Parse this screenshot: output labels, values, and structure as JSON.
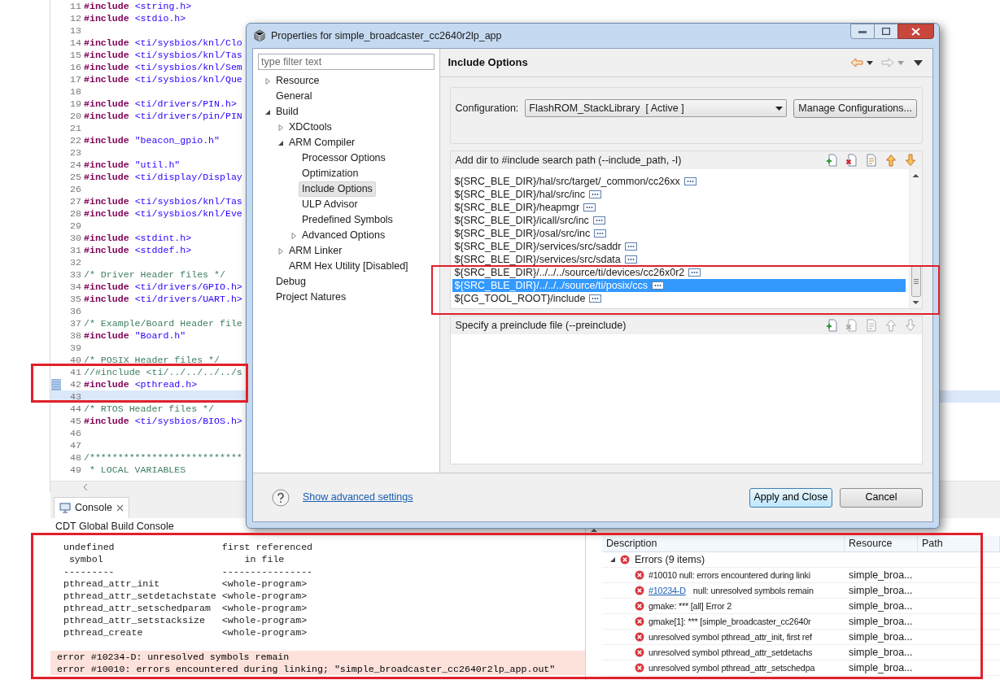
{
  "editor": {
    "lines": [
      {
        "number": "11",
        "kind": "include",
        "keyword": "#include",
        "target": "<string.h>",
        "marker": false,
        "current": false
      },
      {
        "number": "12",
        "kind": "include",
        "keyword": "#include",
        "target": "<stdio.h>",
        "marker": false,
        "current": false
      },
      {
        "number": "13",
        "kind": "blank",
        "marker": false,
        "current": false
      },
      {
        "number": "14",
        "kind": "include",
        "keyword": "#include",
        "target": "<ti/sysbios/knl/Clo",
        "marker": false,
        "current": false
      },
      {
        "number": "15",
        "kind": "include",
        "keyword": "#include",
        "target": "<ti/sysbios/knl/Tas",
        "marker": false,
        "current": false
      },
      {
        "number": "16",
        "kind": "include",
        "keyword": "#include",
        "target": "<ti/sysbios/knl/Sem",
        "marker": false,
        "current": false
      },
      {
        "number": "17",
        "kind": "include",
        "keyword": "#include",
        "target": "<ti/sysbios/knl/Que",
        "marker": false,
        "current": false
      },
      {
        "number": "18",
        "kind": "blank",
        "marker": false,
        "current": false
      },
      {
        "number": "19",
        "kind": "include",
        "keyword": "#include",
        "target": "<ti/drivers/PIN.h>",
        "marker": false,
        "current": false
      },
      {
        "number": "20",
        "kind": "include",
        "keyword": "#include",
        "target": "<ti/drivers/pin/PIN",
        "marker": false,
        "current": false
      },
      {
        "number": "21",
        "kind": "blank",
        "marker": false,
        "current": false
      },
      {
        "number": "22",
        "kind": "include",
        "keyword": "#include",
        "target": "\"beacon_gpio.h\"",
        "marker": false,
        "current": false
      },
      {
        "number": "23",
        "kind": "blank",
        "marker": false,
        "current": false
      },
      {
        "number": "24",
        "kind": "include",
        "keyword": "#include",
        "target": "\"util.h\"",
        "marker": false,
        "current": false
      },
      {
        "number": "25",
        "kind": "include",
        "keyword": "#include",
        "target": "<ti/display/Display",
        "marker": false,
        "current": false
      },
      {
        "number": "26",
        "kind": "blank",
        "marker": false,
        "current": false
      },
      {
        "number": "27",
        "kind": "include",
        "keyword": "#include",
        "target": "<ti/sysbios/knl/Tas",
        "marker": false,
        "current": false
      },
      {
        "number": "28",
        "kind": "include",
        "keyword": "#include",
        "target": "<ti/sysbios/knl/Eve",
        "marker": false,
        "current": false
      },
      {
        "number": "29",
        "kind": "blank",
        "marker": false,
        "current": false
      },
      {
        "number": "30",
        "kind": "include",
        "keyword": "#include",
        "target": "<stdint.h>",
        "marker": false,
        "current": false
      },
      {
        "number": "31",
        "kind": "include",
        "keyword": "#include",
        "target": "<stddef.h>",
        "marker": false,
        "current": false
      },
      {
        "number": "32",
        "kind": "blank",
        "marker": false,
        "current": false
      },
      {
        "number": "33",
        "kind": "comment",
        "text": "/* Driver Header files */",
        "marker": false,
        "current": false
      },
      {
        "number": "34",
        "kind": "include",
        "keyword": "#include",
        "target": "<ti/drivers/GPIO.h>",
        "marker": false,
        "current": false
      },
      {
        "number": "35",
        "kind": "include",
        "keyword": "#include",
        "target": "<ti/drivers/UART.h>",
        "marker": false,
        "current": false
      },
      {
        "number": "36",
        "kind": "blank",
        "marker": false,
        "current": false
      },
      {
        "number": "37",
        "kind": "comment",
        "text": "/* Example/Board Header file",
        "marker": false,
        "current": false
      },
      {
        "number": "38",
        "kind": "include",
        "keyword": "#include",
        "target": "\"Board.h\"",
        "marker": false,
        "current": false
      },
      {
        "number": "39",
        "kind": "blank",
        "marker": false,
        "current": false
      },
      {
        "number": "40",
        "kind": "comment",
        "text": "/* POSIX Header files */",
        "marker": false,
        "current": false
      },
      {
        "number": "41",
        "kind": "comment",
        "text": "//#include <ti/../../../../s",
        "marker": false,
        "current": false
      },
      {
        "number": "42",
        "kind": "include",
        "keyword": "#include",
        "target": "<pthread.h>",
        "marker": true,
        "current": false
      },
      {
        "number": "43",
        "kind": "blank",
        "marker": false,
        "current": true
      },
      {
        "number": "44",
        "kind": "comment",
        "text": "/* RTOS Header files */",
        "marker": false,
        "current": false
      },
      {
        "number": "45",
        "kind": "include",
        "keyword": "#include",
        "target": "<ti/sysbios/BIOS.h>",
        "marker": false,
        "current": false
      },
      {
        "number": "46",
        "kind": "blank",
        "marker": false,
        "current": false
      },
      {
        "number": "47",
        "kind": "blank",
        "marker": false,
        "current": false
      },
      {
        "number": "48",
        "kind": "comment",
        "text": "/***************************",
        "marker": false,
        "current": false
      },
      {
        "number": "49",
        "kind": "comment",
        "text": " * LOCAL VARIABLES",
        "marker": false,
        "current": false
      }
    ]
  },
  "console": {
    "tab": "Console",
    "title": "CDT Global Build Console",
    "lines": [
      {
        "kind": "output",
        "text": " undefined                   first referenced"
      },
      {
        "kind": "output",
        "text": "  symbol                         in file"
      },
      {
        "kind": "output",
        "text": " ---------                   ----------------"
      },
      {
        "kind": "output",
        "text": " pthread_attr_init           <whole-program>"
      },
      {
        "kind": "output",
        "text": " pthread_attr_setdetachstate <whole-program>"
      },
      {
        "kind": "output",
        "text": " pthread_attr_setschedparam  <whole-program>"
      },
      {
        "kind": "output",
        "text": " pthread_attr_setstacksize   <whole-program>"
      },
      {
        "kind": "output",
        "text": " pthread_create              <whole-program>"
      },
      {
        "kind": "blank"
      },
      {
        "kind": "error",
        "text": "error #10234-D: unresolved symbols remain"
      },
      {
        "kind": "error",
        "text": "error #10010: errors encountered during linking; \"simple_broadcaster_cc2640r2lp_app.out\""
      }
    ]
  },
  "problems": {
    "columns": [
      "Description",
      "Resource",
      "Path"
    ],
    "group": {
      "label": "Errors (9 items)",
      "expanded": true
    },
    "rows": [
      {
        "kind": "plain",
        "description": "#10010 null: errors encountered during linki",
        "resource": "simple_broa..."
      },
      {
        "kind": "linked",
        "link": "#10234-D",
        "description": "null: unresolved symbols remain",
        "resource": "simple_broa..."
      },
      {
        "kind": "plain",
        "description": "gmake: *** [all] Error 2",
        "resource": "simple_broa..."
      },
      {
        "kind": "plain",
        "description": "gmake[1]: *** [simple_broadcaster_cc2640r",
        "resource": "simple_broa..."
      },
      {
        "kind": "plain",
        "description": "unresolved symbol pthread_attr_init, first ref",
        "resource": "simple_broa..."
      },
      {
        "kind": "plain",
        "description": "unresolved symbol pthread_attr_setdetachs",
        "resource": "simple_broa..."
      },
      {
        "kind": "plain",
        "description": "unresolved symbol pthread_attr_setschedpa",
        "resource": "simple_broa..."
      }
    ]
  },
  "dialog": {
    "title": "Properties for simple_broadcaster_cc2640r2lp_app",
    "filter": {
      "placeholder": "type filter text"
    },
    "tree": [
      {
        "label": "Resource",
        "kind": "group",
        "expanded": false,
        "selected": false
      },
      {
        "label": "General",
        "kind": "page",
        "selected": false
      },
      {
        "label": "Build",
        "kind": "group",
        "expanded": true,
        "selected": false,
        "children": [
          {
            "label": "XDCtools",
            "kind": "group",
            "expanded": false,
            "selected": false
          },
          {
            "label": "ARM Compiler",
            "kind": "group",
            "expanded": true,
            "selected": false,
            "children": [
              {
                "label": "Processor Options",
                "kind": "page",
                "selected": false
              },
              {
                "label": "Optimization",
                "kind": "page",
                "selected": false
              },
              {
                "label": "Include Options",
                "kind": "page",
                "selected": true
              },
              {
                "label": "ULP Advisor",
                "kind": "page",
                "selected": false
              },
              {
                "label": "Predefined Symbols",
                "kind": "page",
                "selected": false
              },
              {
                "label": "Advanced Options",
                "kind": "group",
                "expanded": false,
                "selected": false
              }
            ]
          },
          {
            "label": "ARM Linker",
            "kind": "group",
            "expanded": false,
            "selected": false
          },
          {
            "label": "ARM Hex Utility  [Disabled]",
            "kind": "page",
            "selected": false
          }
        ]
      },
      {
        "label": "Debug",
        "kind": "page",
        "selected": false
      },
      {
        "label": "Project Natures",
        "kind": "page",
        "selected": false
      }
    ],
    "page_title": "Include Options",
    "configuration": {
      "label": "Configuration:",
      "value": "FlashROM_StackLibrary  [ Active ]",
      "button": "Manage Configurations..."
    },
    "sections": [
      {
        "title": "Add dir to #include search path (--include_path, -I)",
        "actions_enabled": true,
        "items": [
          {
            "text": "${SRC_BLE_DIR}/hal/src/target/_common/cc26xx",
            "selected": false
          },
          {
            "text": "${SRC_BLE_DIR}/hal/src/inc",
            "selected": false
          },
          {
            "text": "${SRC_BLE_DIR}/heapmgr",
            "selected": false
          },
          {
            "text": "${SRC_BLE_DIR}/icall/src/inc",
            "selected": false
          },
          {
            "text": "${SRC_BLE_DIR}/osal/src/inc",
            "selected": false
          },
          {
            "text": "${SRC_BLE_DIR}/services/src/saddr",
            "selected": false
          },
          {
            "text": "${SRC_BLE_DIR}/services/src/sdata",
            "selected": false
          },
          {
            "text": "${SRC_BLE_DIR}/../../../source/ti/devices/cc26x0r2",
            "selected": false
          },
          {
            "text": "${SRC_BLE_DIR}/../../../source/ti/posix/ccs",
            "selected": true
          },
          {
            "text": "${CG_TOOL_ROOT}/include",
            "selected": false
          }
        ]
      },
      {
        "title": "Specify a preinclude file (--preinclude)",
        "actions_enabled": false
      }
    ],
    "advanced_link": "Show advanced settings",
    "buttons": [
      {
        "label": "Apply and Close",
        "default": true
      },
      {
        "label": "Cancel",
        "default": false
      }
    ]
  }
}
